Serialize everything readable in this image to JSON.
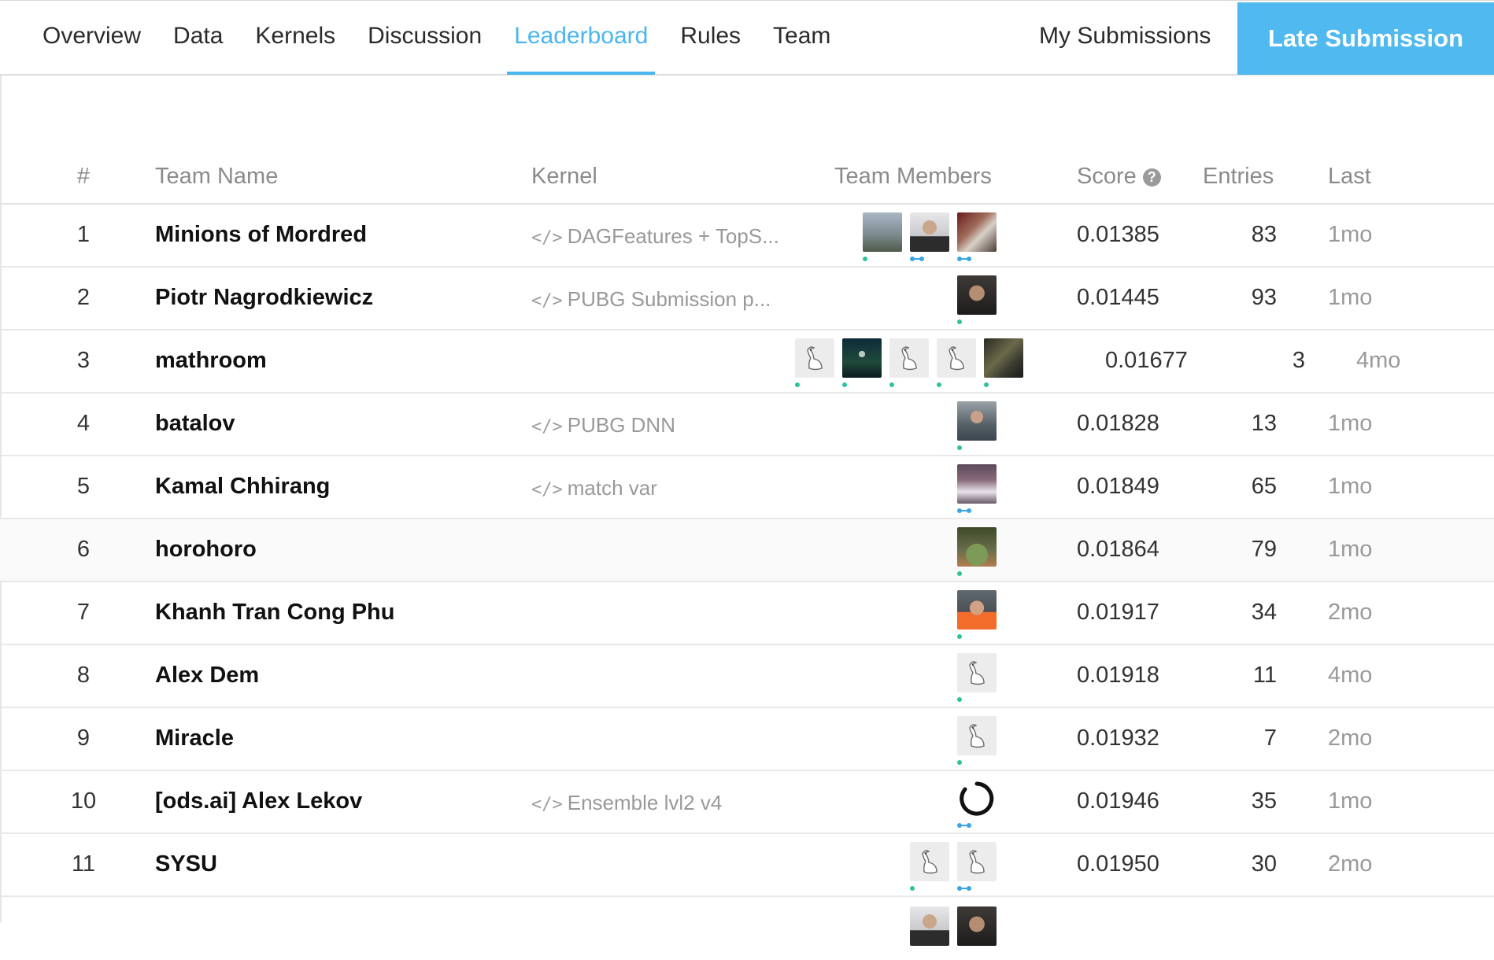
{
  "tabs": [
    {
      "label": "Overview",
      "active": false
    },
    {
      "label": "Data",
      "active": false
    },
    {
      "label": "Kernels",
      "active": false
    },
    {
      "label": "Discussion",
      "active": false
    },
    {
      "label": "Leaderboard",
      "active": true
    },
    {
      "label": "Rules",
      "active": false
    },
    {
      "label": "Team",
      "active": false
    }
  ],
  "actions": {
    "my_submissions": "My Submissions",
    "late_submission": "Late Submission"
  },
  "columns": {
    "rank": "#",
    "team": "Team Name",
    "kernel": "Kernel",
    "members": "Team Members",
    "score": "Score",
    "entries": "Entries",
    "last": "Last"
  },
  "icons": {
    "score_help": "question-circle-icon",
    "kernel": "code-icon"
  },
  "colors": {
    "accent": "#4ab6f0",
    "button": "#50b9f0"
  },
  "rows": [
    {
      "rank": "1",
      "team": "Minions of Mordred",
      "kernel": "DAGFeatures + TopS...",
      "score": "0.01385",
      "entries": "83",
      "last": "1mo"
    },
    {
      "rank": "2",
      "team": "Piotr Nagrodkiewicz",
      "kernel": "PUBG Submission p...",
      "score": "0.01445",
      "entries": "93",
      "last": "1mo"
    },
    {
      "rank": "3",
      "team": "mathroom",
      "kernel": "",
      "score": "0.01677",
      "entries": "3",
      "last": "4mo"
    },
    {
      "rank": "4",
      "team": "batalov",
      "kernel": "PUBG DNN",
      "score": "0.01828",
      "entries": "13",
      "last": "1mo"
    },
    {
      "rank": "5",
      "team": "Kamal Chhirang",
      "kernel": "match var",
      "score": "0.01849",
      "entries": "65",
      "last": "1mo"
    },
    {
      "rank": "6",
      "team": "horohoro",
      "kernel": "",
      "score": "0.01864",
      "entries": "79",
      "last": "1mo"
    },
    {
      "rank": "7",
      "team": "Khanh Tran Cong Phu",
      "kernel": "",
      "score": "0.01917",
      "entries": "34",
      "last": "2mo"
    },
    {
      "rank": "8",
      "team": "Alex Dem",
      "kernel": "",
      "score": "0.01918",
      "entries": "11",
      "last": "4mo"
    },
    {
      "rank": "9",
      "team": "Miracle",
      "kernel": "",
      "score": "0.01932",
      "entries": "7",
      "last": "2mo"
    },
    {
      "rank": "10",
      "team": "[ods.ai] Alex Lekov",
      "kernel": "Ensemble lvl2 v4",
      "score": "0.01946",
      "entries": "35",
      "last": "1mo"
    },
    {
      "rank": "11",
      "team": "SYSU",
      "kernel": "",
      "score": "0.01950",
      "entries": "30",
      "last": "2mo"
    }
  ]
}
